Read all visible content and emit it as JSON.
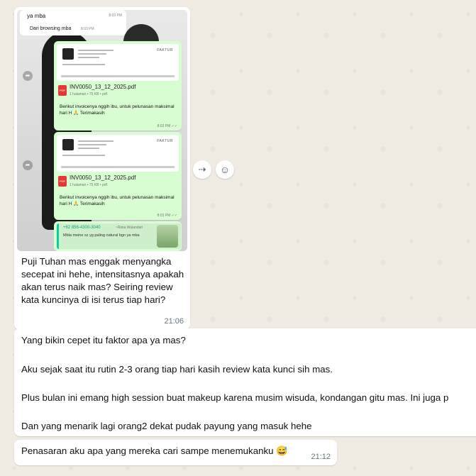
{
  "screenshot": {
    "top_chat": {
      "line1": "ya mba",
      "line2": "Dari browsing mba",
      "time1": "8:03 PM",
      "time2": "8:03 PM"
    },
    "invoice1": {
      "header_title": "FAKTUR",
      "file_name": "INV0050_13_12_2025.pdf",
      "file_meta": "1 halaman • 75 KB • pdf",
      "message": "Berikut invoicenya nggih ibu, untuk pelunasan maksimal hari H 🙏 Terimakasih",
      "time": "8:03 PM ✓✓"
    },
    "invoice2": {
      "header_title": "FAKTUR",
      "file_name": "INV0050_13_12_2025.pdf",
      "file_meta": "1 halaman • 75 KB • pdf",
      "message": "Berikut invoicenya nggih ibu, untuk pelunasan maksimal hari H 🙏 Terimakasih",
      "time": "8:03 PM ✓✓"
    },
    "contact_card": {
      "number": "+62 856-4300-3040",
      "sender": "~Rinia Wulandari",
      "text": "Mbla meine sz yg paling natural bgn ya mba"
    }
  },
  "image_message": {
    "caption": "Puji Tuhan mas enggak menyangka secepat ini hehe, intensitasnya apakah akan terus naik mas? Seiring review kata kuncinya di isi terus tiap hari?",
    "time": "21:06"
  },
  "actions": {
    "forward_icon": "forward-icon",
    "emoji_icon": "emoji-icon",
    "forward_glyph": "⇢",
    "emoji_glyph": "☺"
  },
  "reply_message": {
    "line1": "Yang bikin cepet itu faktor apa ya mas?",
    "line2": "Aku sejak saat itu rutin 2-3 orang tiap hari kasih review kata kunci sih mas.",
    "line3": "Plus bulan ini emang high session buat makeup karena musim wisuda, kondangan gitu mas. Ini juga p",
    "line4": "Dan yang menarik lagi orang2 dekat pudak payung yang masuk hehe"
  },
  "last_message": {
    "text": "Penasaran aku apa yang mereka cari sampe menemukanku 😅",
    "time": "21:12"
  }
}
